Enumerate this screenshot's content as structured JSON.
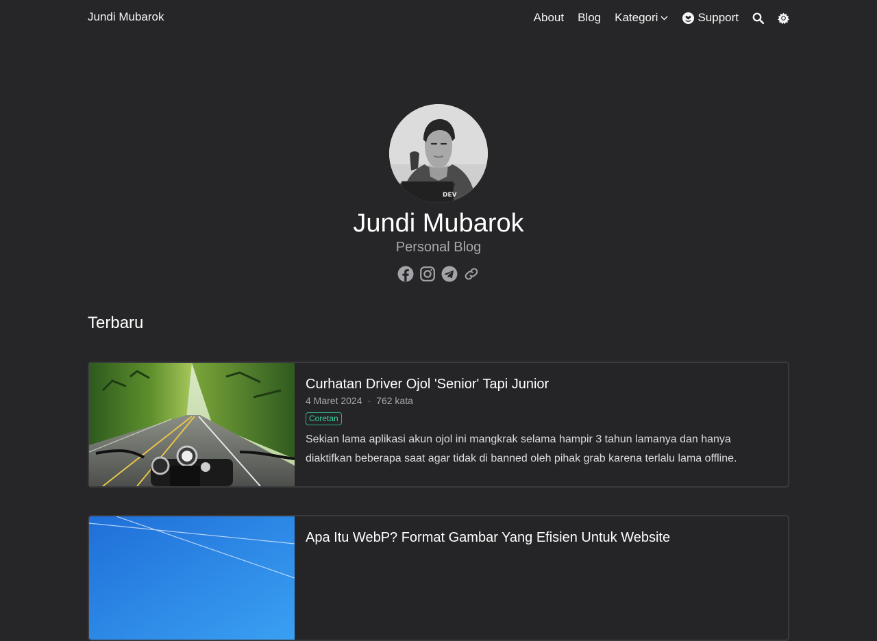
{
  "nav": {
    "brand": "Jundi Mubarok",
    "items": [
      {
        "label": "About"
      },
      {
        "label": "Blog"
      },
      {
        "label": "Kategori"
      },
      {
        "label": "Support"
      }
    ]
  },
  "hero": {
    "title": "Jundi Mubarok",
    "subtitle": "Personal Blog",
    "laptop_sticker": "DEV",
    "socials": [
      "facebook-icon",
      "instagram-icon",
      "telegram-icon",
      "link-icon"
    ]
  },
  "section": {
    "title": "Terbaru"
  },
  "posts": [
    {
      "title": "Curhatan Driver Ojol 'Senior' Tapi Junior",
      "date": "4 Maret 2024",
      "words": "762 kata",
      "tag": "Coretan",
      "excerpt": "Sekian lama aplikasi akun ojol ini mangkrak selama hampir 3 tahun lamanya dan hanya diaktifkan beberapa saat agar tidak di banned oleh pihak grab karena terlalu lama offline."
    },
    {
      "title": "Apa Itu WebP? Format Gambar Yang Efisien Untuk Website"
    }
  ],
  "colors": {
    "background": "#262628",
    "tag_accent": "#35d49e",
    "muted": "#a8a8ad"
  }
}
